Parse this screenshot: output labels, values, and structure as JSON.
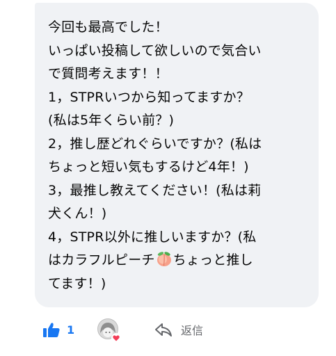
{
  "comment": {
    "lines": [
      "今回も最高でした！",
      "いっぱい投稿して欲しいので気合い",
      "で質問考えます！！",
      "1，STPRいつから知ってますか？",
      "(私は5年くらい前？)",
      "2，推し歴どれぐらいですか？(私は",
      "ちょっと短い気もするけど4年！)",
      "3，最推し教えてください！(私は莉",
      "犬くん！)",
      "4，STPR以外に推しいますか？(私"
    ],
    "line11_before": "はカラフルピーチ",
    "line11_after": "ちょっと推し",
    "line12": "てます！)",
    "emoji_icon": "peach-emoji-icon"
  },
  "actions": {
    "like_count": "1",
    "like_icon": "thumbs-up-icon",
    "reaction_badge": "heart-icon",
    "reply_label": "返信",
    "reply_icon": "reply-arrow-icon"
  },
  "colors": {
    "bubble_bg": "#f0f2f5",
    "text": "#050505",
    "accent": "#1877f2",
    "muted": "#65676b",
    "heart": "#f33e58"
  }
}
